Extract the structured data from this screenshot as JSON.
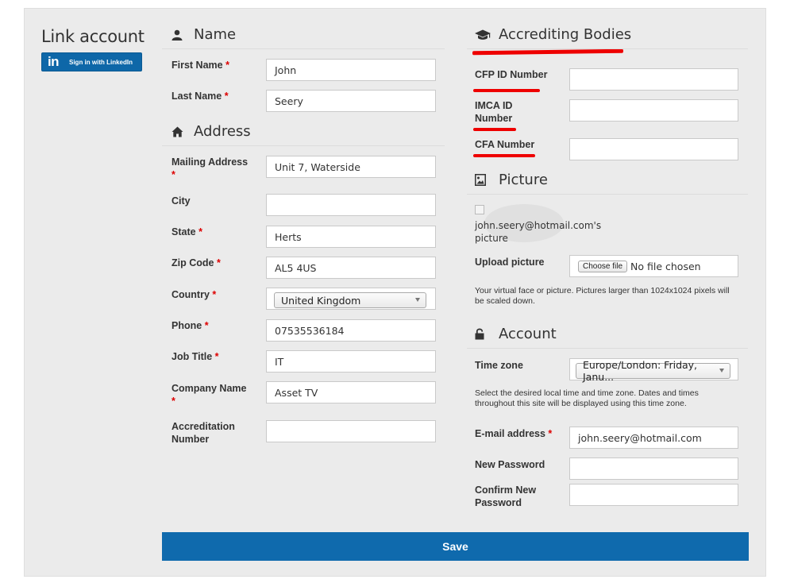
{
  "sidebar": {
    "title": "Link account",
    "linkedin_logo": "in",
    "linkedin_label": "Sign in with LinkedIn"
  },
  "sections": {
    "name": "Name",
    "address": "Address",
    "accrediting": "Accrediting Bodies",
    "picture": "Picture",
    "account": "Account"
  },
  "icons": {
    "name": "user-icon",
    "address": "home-icon",
    "accrediting": "graduation-cap-icon",
    "picture": "image-icon",
    "account": "unlock-icon",
    "linkedin": "linkedin-icon"
  },
  "required_marker": "*",
  "fields": {
    "first_name": {
      "label": "First Name",
      "value": "John"
    },
    "last_name": {
      "label": "Last Name",
      "value": "Seery"
    },
    "mailing_address": {
      "label": "Mailing Address",
      "value": "Unit 7, Waterside"
    },
    "city": {
      "label": "City",
      "value": ""
    },
    "state": {
      "label": "State",
      "value": "Herts"
    },
    "zip": {
      "label": "Zip Code",
      "value": "AL5 4US"
    },
    "country": {
      "label": "Country",
      "value": "United Kingdom"
    },
    "phone": {
      "label": "Phone",
      "value": "07535536184"
    },
    "job_title": {
      "label": "Job Title",
      "value": "IT"
    },
    "company": {
      "label": "Company Name",
      "value": "Asset TV"
    },
    "accreditation": {
      "label_line1": "Accreditation",
      "label_line2": "Number",
      "value": ""
    },
    "cfp": {
      "label": "CFP ID Number",
      "value": ""
    },
    "imca": {
      "label_line1": "IMCA ID",
      "label_line2": "Number",
      "value": ""
    },
    "cfa": {
      "label": "CFA Number",
      "value": ""
    },
    "upload": {
      "label": "Upload picture",
      "button": "Choose file",
      "status": "No file chosen"
    },
    "timezone": {
      "label": "Time zone",
      "value": "Europe/London: Friday, Janu..."
    },
    "email": {
      "label": "E-mail address",
      "value": "john.seery@hotmail.com"
    },
    "new_password": {
      "label": "New Password",
      "value": ""
    },
    "confirm_password": {
      "label_line1": "Confirm New",
      "label_line2": "Password",
      "value": ""
    }
  },
  "picture": {
    "alt_line1": "john.seery@hotmail.com's",
    "alt_line2": "picture",
    "note": "Your virtual face or picture. Pictures larger than 1024x1024 pixels will be scaled down."
  },
  "timezone_note": "Select the desired local time and time zone. Dates and times throughout this site will be displayed using this time zone.",
  "save_label": "Save",
  "colors": {
    "primary": "#0f6aad",
    "linkedin": "#0e67a8",
    "required": "#dd0000",
    "annotation": "#ee0000",
    "panel": "#ebebeb"
  }
}
